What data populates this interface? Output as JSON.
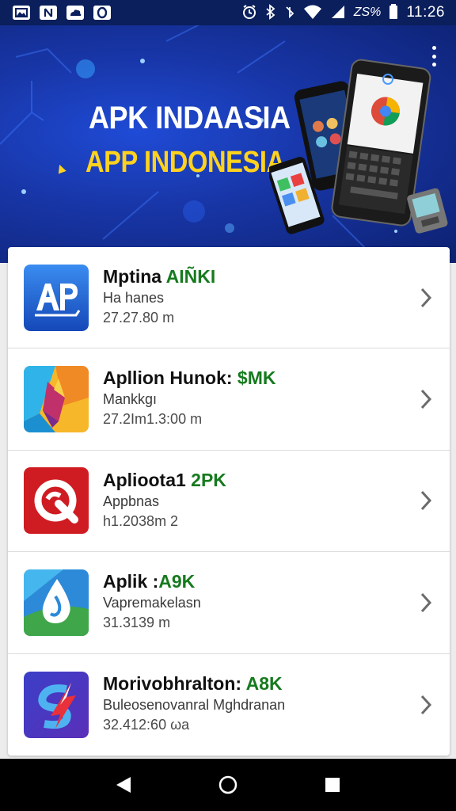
{
  "status_bar": {
    "notifications": [
      "photo-icon",
      "nfc-icon",
      "cloud-icon",
      "opera-icon"
    ],
    "battery_text": "ZS%",
    "time": "11:26"
  },
  "banner": {
    "title": "APK INDAASIA",
    "subtitle": "APP INDONESIA"
  },
  "apps": [
    {
      "name": "Mptina ",
      "name_badge": "AIÑKI",
      "subtitle": "Ha hanes",
      "meta": "27.27.80 m",
      "icon": "ap-logo-icon",
      "color": "#1e64d6"
    },
    {
      "name": "Apllion Hunok: ",
      "name_badge": "$MK",
      "subtitle": "Mankkgı",
      "meta": "27.2Im1.3:00 m",
      "icon": "colorful-bird-icon",
      "color": "#f5a623"
    },
    {
      "name": "Aplioota1",
      "name_badge": " 2PK",
      "subtitle": "Appbnas",
      "meta": "h1.2038m  2",
      "icon": "red-q-icon",
      "color": "#c8161d"
    },
    {
      "name": "Aplik :",
      "name_badge": "A9K",
      "subtitle": "Vapremakelasn",
      "meta": "31.3139 m",
      "icon": "water-drop-icon",
      "color": "#3ea34a"
    },
    {
      "name": "Morivobhralton: ",
      "name_badge": "A8K",
      "subtitle": "Buleosenovanral Mghdranan",
      "meta": "32.412:60 ωa",
      "icon": "s-arrow-icon",
      "color": "#3a3fcf"
    }
  ]
}
